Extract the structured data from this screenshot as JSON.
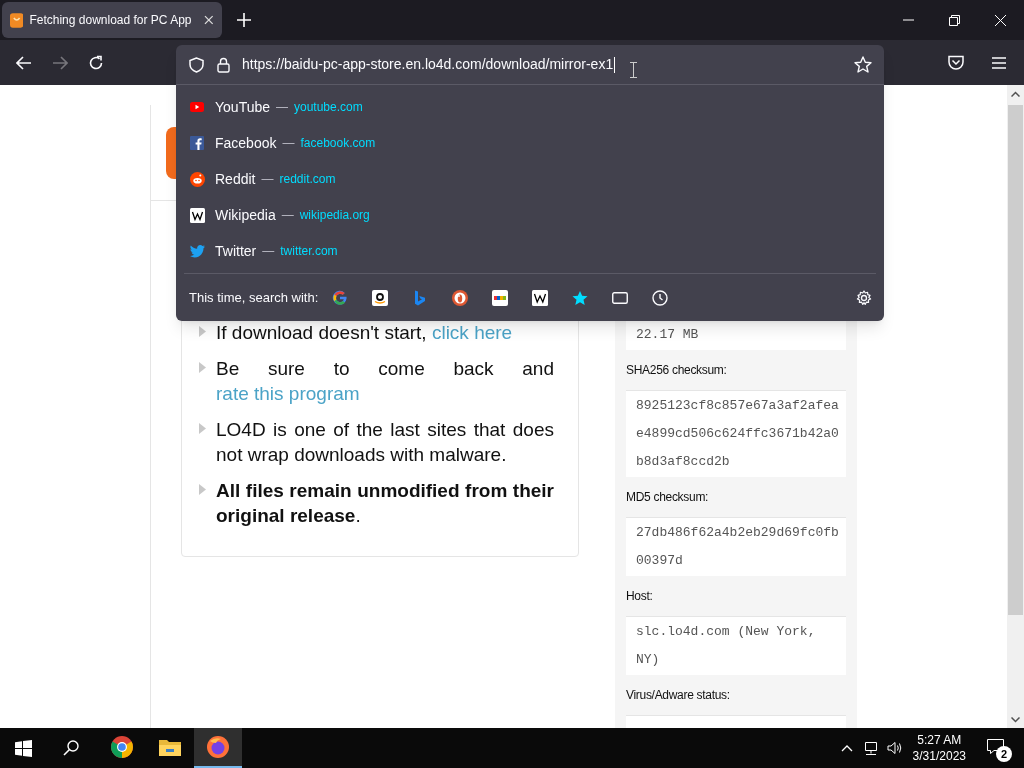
{
  "tab": {
    "title": "Fetching download for PC App",
    "selected": true
  },
  "address": "https://baidu-pc-app-store.en.lo4d.com/download/mirror-ex1",
  "suggestions": [
    {
      "kind": "youtube",
      "title": "YouTube",
      "separator": "—",
      "url": "youtube.com"
    },
    {
      "kind": "facebook",
      "title": "Facebook",
      "separator": "—",
      "url": "facebook.com"
    },
    {
      "kind": "reddit",
      "title": "Reddit",
      "separator": "—",
      "url": "reddit.com"
    },
    {
      "kind": "wikipedia",
      "title": "Wikipedia",
      "separator": "—",
      "url": "wikipedia.org"
    },
    {
      "kind": "twitter",
      "title": "Twitter",
      "separator": "—",
      "url": "twitter.com"
    }
  ],
  "search_with": {
    "label": "This time, search with:",
    "engines": [
      {
        "kind": "google"
      },
      {
        "kind": "amazon"
      },
      {
        "kind": "bing"
      },
      {
        "kind": "duckduckgo"
      },
      {
        "kind": "ebay"
      },
      {
        "kind": "wikipedia"
      },
      {
        "kind": "bookmarks"
      },
      {
        "kind": "tabs"
      },
      {
        "kind": "history"
      }
    ]
  },
  "page": {
    "list": [
      {
        "segments": [
          {
            "kind": "text",
            "text": "If download doesn't start, "
          },
          {
            "kind": "link",
            "text": "click here"
          }
        ]
      },
      {
        "segments": [
          {
            "kind": "text",
            "text": "Be sure to come back and "
          },
          {
            "kind": "link",
            "text": "rate this program"
          }
        ]
      },
      {
        "segments": [
          {
            "kind": "text",
            "text": "LO4D is one of the last sites that does not wrap downloads with malware."
          }
        ]
      },
      {
        "segments": [
          {
            "kind": "text",
            "text": "**All files remain unmodified from their original release**."
          }
        ]
      }
    ],
    "details": [
      {
        "value": "22.17 MB"
      },
      {
        "label": "SHA256 checksum:",
        "value": "8925123cf8c857e67a3af2afeae4899cd506c624ffc3671b42a0b8d3af8ccd2b"
      },
      {
        "label": "MD5 checksum:",
        "value": "27db486f62a4b2eb29d69fc0fb00397d"
      },
      {
        "label": "Host:",
        "value": "slc.lo4d.com (New York, NY)"
      },
      {
        "label": "Virus/Adware status:"
      }
    ]
  },
  "taskbar": {
    "apps": [
      {
        "kind": "chrome",
        "active": false
      },
      {
        "kind": "folder",
        "active": false
      },
      {
        "kind": "firefox",
        "active": true
      }
    ],
    "time": "5:27 AM",
    "date": "3/31/2023",
    "notifications": "2"
  }
}
